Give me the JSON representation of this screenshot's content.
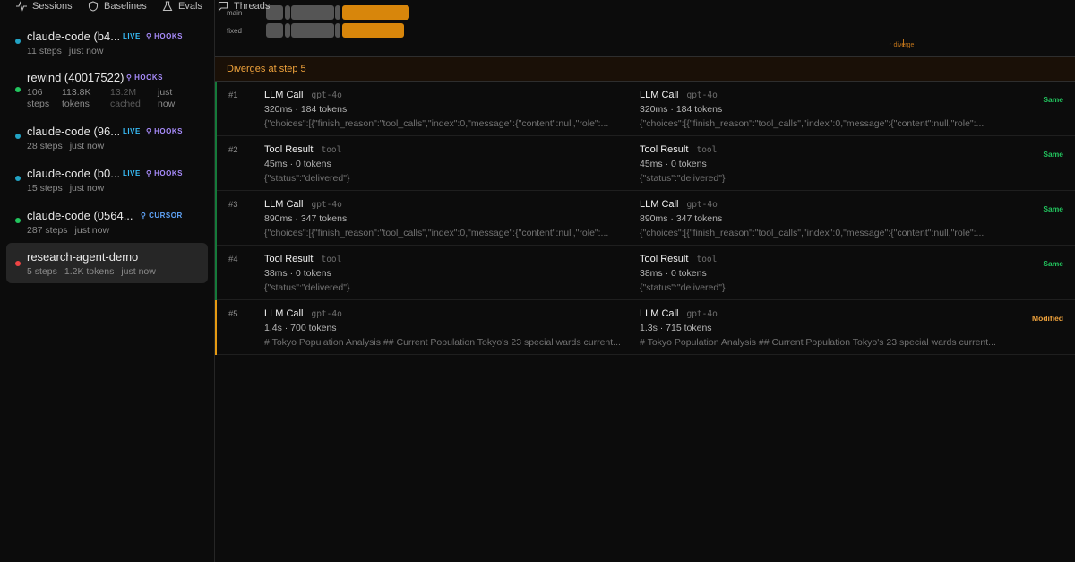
{
  "nav": {
    "sessions": "Sessions",
    "baselines": "Baselines",
    "evals": "Evals",
    "threads": "Threads"
  },
  "sessions": [
    {
      "name": "claude-code (b4...",
      "steps": "11 steps",
      "time": "just now",
      "live": "LIVE",
      "tag": "HOOKS",
      "dot": "#22a3c4"
    },
    {
      "name": "rewind (40017522)",
      "tag": "HOOKS",
      "stats": [
        "106",
        "steps",
        "113.8K",
        "tokens",
        "13.2M",
        "cached",
        "just",
        "now"
      ],
      "dot": "#22c55e"
    },
    {
      "name": "claude-code (96...",
      "steps": "28 steps",
      "time": "just now",
      "live": "LIVE",
      "tag": "HOOKS",
      "dot": "#22a3c4"
    },
    {
      "name": "claude-code (b0...",
      "steps": "15 steps",
      "time": "just now",
      "live": "LIVE",
      "tag": "HOOKS",
      "dot": "#22a3c4"
    },
    {
      "name": "claude-code (0564...",
      "steps": "287 steps",
      "time": "just now",
      "tag": "CURSOR",
      "dot": "#22c55e"
    },
    {
      "name": "research-agent-demo",
      "steps": "5 steps",
      "tokens": "1.2K tokens",
      "time": "just now",
      "dot": "#ef4444"
    }
  ],
  "timeline": {
    "labels": [
      "main",
      "fixed"
    ],
    "diverge": "↑ diverge"
  },
  "banner": "Diverges at step 5",
  "steps": [
    {
      "num": "#1",
      "left": {
        "title": "LLM Call",
        "kind": "gpt-4o",
        "stats": "320ms · 184 tokens",
        "content": "{\"choices\":[{\"finish_reason\":\"tool_calls\",\"index\":0,\"message\":{\"content\":null,\"role\":..."
      },
      "right": {
        "title": "LLM Call",
        "kind": "gpt-4o",
        "stats": "320ms · 184 tokens",
        "content": "{\"choices\":[{\"finish_reason\":\"tool_calls\",\"index\":0,\"message\":{\"content\":null,\"role\":..."
      },
      "status": "Same"
    },
    {
      "num": "#2",
      "left": {
        "title": "Tool Result",
        "kind": "tool",
        "stats": "45ms · 0 tokens",
        "content": "{\"status\":\"delivered\"}"
      },
      "right": {
        "title": "Tool Result",
        "kind": "tool",
        "stats": "45ms · 0 tokens",
        "content": "{\"status\":\"delivered\"}"
      },
      "status": "Same"
    },
    {
      "num": "#3",
      "left": {
        "title": "LLM Call",
        "kind": "gpt-4o",
        "stats": "890ms · 347 tokens",
        "content": "{\"choices\":[{\"finish_reason\":\"tool_calls\",\"index\":0,\"message\":{\"content\":null,\"role\":..."
      },
      "right": {
        "title": "LLM Call",
        "kind": "gpt-4o",
        "stats": "890ms · 347 tokens",
        "content": "{\"choices\":[{\"finish_reason\":\"tool_calls\",\"index\":0,\"message\":{\"content\":null,\"role\":..."
      },
      "status": "Same"
    },
    {
      "num": "#4",
      "left": {
        "title": "Tool Result",
        "kind": "tool",
        "stats": "38ms · 0 tokens",
        "content": "{\"status\":\"delivered\"}"
      },
      "right": {
        "title": "Tool Result",
        "kind": "tool",
        "stats": "38ms · 0 tokens",
        "content": "{\"status\":\"delivered\"}"
      },
      "status": "Same"
    },
    {
      "num": "#5",
      "left": {
        "title": "LLM Call",
        "kind": "gpt-4o",
        "stats": "1.4s · 700 tokens",
        "content": "# Tokyo Population Analysis ## Current Population Tokyo's 23 special wards current..."
      },
      "right": {
        "title": "LLM Call",
        "kind": "gpt-4o",
        "stats": "1.3s · 715 tokens",
        "content": "# Tokyo Population Analysis ## Current Population Tokyo's 23 special wards current..."
      },
      "status": "Modified"
    }
  ],
  "colors": {
    "same": "#22c55e",
    "modified": "#f0a33c",
    "accent_orange": "#d8860b"
  }
}
